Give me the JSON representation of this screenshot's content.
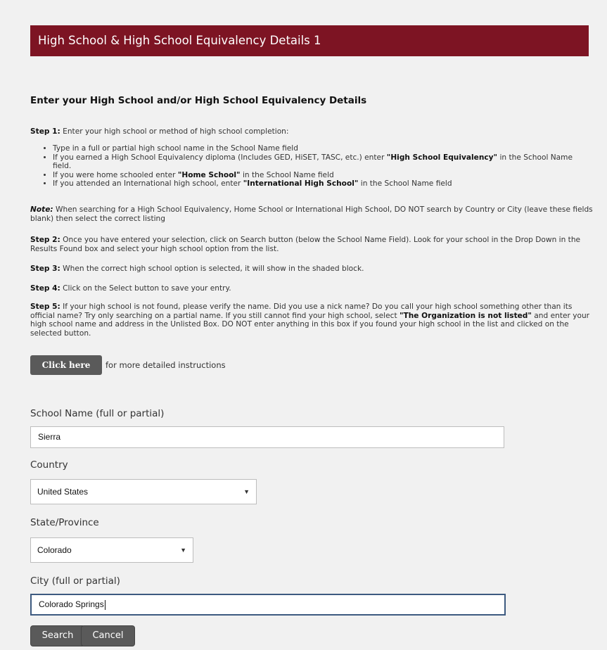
{
  "header": {
    "title": "High School & High School Equivalency Details 1"
  },
  "instructions": {
    "heading": "Enter your High School and/or High School Equivalency Details",
    "step1_label": "Step 1:",
    "step1_text": "Enter your high school or method of high school completion:",
    "bullets": [
      {
        "pre": "Type in a full or partial high school name in the School Name field",
        "bold": "",
        "post": ""
      },
      {
        "pre": "If you earned a High School Equivalency diploma (Includes GED, HiSET, TASC, etc.) enter ",
        "bold": "\"High School Equivalency\"",
        "post": " in the School Name field."
      },
      {
        "pre": "If you were home schooled enter ",
        "bold": "\"Home School\"",
        "post": " in the School Name field"
      },
      {
        "pre": "If you attended an International high school, enter ",
        "bold": "\"International High School\"",
        "post": " in the School Name field"
      }
    ],
    "note_label": "Note:",
    "note_text": "When searching for a High School Equivalency, Home School or International High School, DO NOT search by Country or City (leave these fields blank) then select the correct listing",
    "step2_label": "Step 2:",
    "step2_text": "Once you have entered your selection, click on Search button (below the School Name Field). Look for your school in the Drop Down in the Results Found box and select your high school option from the list.",
    "step3_label": "Step 3:",
    "step3_text": "When the correct high school option is selected, it will show in the shaded block.",
    "step4_label": "Step 4:",
    "step4_text": "Click on the Select button to save your entry.",
    "step5_label": "Step 5:",
    "step5_text_a": "If your high school is not found, please verify the name. Did you use a nick name? Do you call your high school something other than its official name? Try only searching on a partial name. If you still cannot find your high school, select",
    "step5_bold": "\"The Organization is not listed\"",
    "step5_text_b": "and enter your high school name and address in the Unlisted Box. DO NOT enter anything in this box if you found your high school in the list and clicked on the selected button.",
    "help_button": "Click here",
    "help_text": "for more detailed instructions"
  },
  "form": {
    "school_name_label": "School Name (full or partial)",
    "school_name_value": "Sierra",
    "country_label": "Country",
    "country_value": "United States",
    "state_label": "State/Province",
    "state_value": "Colorado",
    "city_label": "City (full or partial)",
    "city_value": "Colorado Springs",
    "search_button": "Search",
    "cancel_button": "Cancel",
    "caret_icon": "chevron-down-icon"
  }
}
